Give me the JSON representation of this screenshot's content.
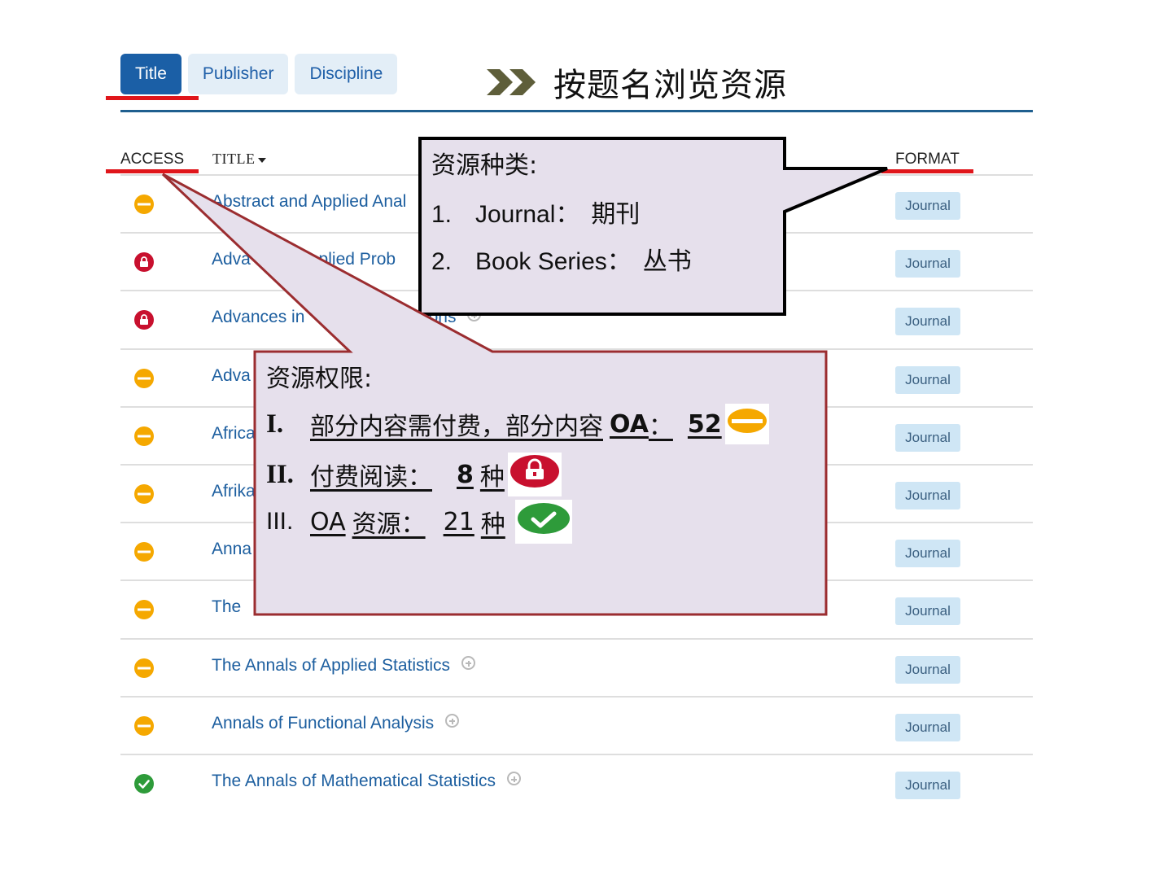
{
  "tabs": [
    {
      "label": "Title",
      "active": true
    },
    {
      "label": "Publisher",
      "active": false
    },
    {
      "label": "Discipline",
      "active": false
    }
  ],
  "heading": "按题名浏览资源",
  "columns": {
    "access": "ACCESS",
    "title": "TITLE",
    "format": "FORMAT"
  },
  "rows": [
    {
      "access": "partial",
      "title": "Abstract and Applied Anal",
      "format": "Journal"
    },
    {
      "access": "locked",
      "title": "Adva",
      "title_tail": "pplied Prob",
      "format": "Journal"
    },
    {
      "access": "locked",
      "title": "Advances in",
      "title_tail": "ations",
      "format": "Journal"
    },
    {
      "access": "partial",
      "title": "Adva",
      "format": "Journal"
    },
    {
      "access": "partial",
      "title": "Africa",
      "format": "Journal"
    },
    {
      "access": "partial",
      "title": "Afrika",
      "format": "Journal"
    },
    {
      "access": "partial",
      "title": "Anna",
      "format": "Journal"
    },
    {
      "access": "partial",
      "title": "The",
      "format": "Journal"
    },
    {
      "access": "partial",
      "title": "The Annals of Applied Statistics",
      "format": "Journal"
    },
    {
      "access": "partial",
      "title": "Annals of Functional Analysis",
      "format": "Journal"
    },
    {
      "access": "open",
      "title": "The Annals of Mathematical Statistics",
      "format": "Journal"
    }
  ],
  "callout_format": {
    "title": "资源种类:",
    "items": [
      {
        "num": "1.",
        "en": "Journal：",
        "cn": "期刊"
      },
      {
        "num": "2.",
        "en": "Book Series：",
        "cn": "丛书"
      }
    ]
  },
  "callout_access": {
    "title": "资源权限:",
    "items": [
      {
        "roman": "I.",
        "text": "部分内容需付费，部分内容",
        "oa": "OA",
        "colon": "：",
        "count": "52",
        "unit": "种",
        "icon": "partial"
      },
      {
        "roman": "II.",
        "text": "付费阅读：",
        "count": "8",
        "unit": "种",
        "icon": "locked"
      },
      {
        "roman": "III.",
        "oa": "OA",
        "text": "资源：",
        "count": "21",
        "unit": "种",
        "icon": "open"
      }
    ]
  },
  "colors": {
    "tab_active": "#1b5fa6",
    "link": "#1c5e9f",
    "partial": "#f5a800",
    "locked": "#c8102e",
    "open": "#2e9b3a",
    "callout_fill": "#e6e0ec",
    "highlight_red": "#e0161b"
  },
  "icons": {
    "heading_arrow": "double-chevron-right-icon",
    "expand": "plus-circle-icon"
  }
}
